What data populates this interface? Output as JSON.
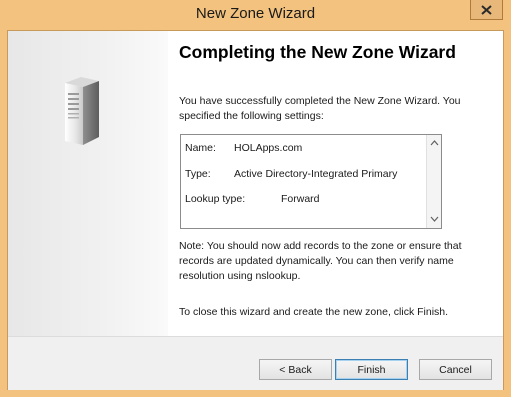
{
  "window": {
    "title": "New Zone Wizard"
  },
  "page": {
    "heading": "Completing the New Zone Wizard",
    "intro": "You have successfully completed the New Zone Wizard. You specified the following settings:",
    "settings": [
      {
        "label": "Name:",
        "value": "HOLApps.com"
      },
      {
        "label": "Type:",
        "value": "Active Directory-Integrated Primary"
      },
      {
        "label": "Lookup type:",
        "value": "Forward"
      }
    ],
    "note": "Note: You should now add records to the zone or ensure that records are updated dynamically. You can then verify name resolution using nslookup.",
    "finish_hint": "To close this wizard and create the new zone, click Finish."
  },
  "buttons": {
    "back": "< Back",
    "finish": "Finish",
    "cancel": "Cancel"
  },
  "icons": {
    "close": "close-icon",
    "server": "server-icon",
    "scroll_up": "scroll-up-icon",
    "scroll_down": "scroll-down-icon"
  },
  "colors": {
    "frame": "#f2c27e",
    "default_button_border": "#3c7fb1"
  }
}
